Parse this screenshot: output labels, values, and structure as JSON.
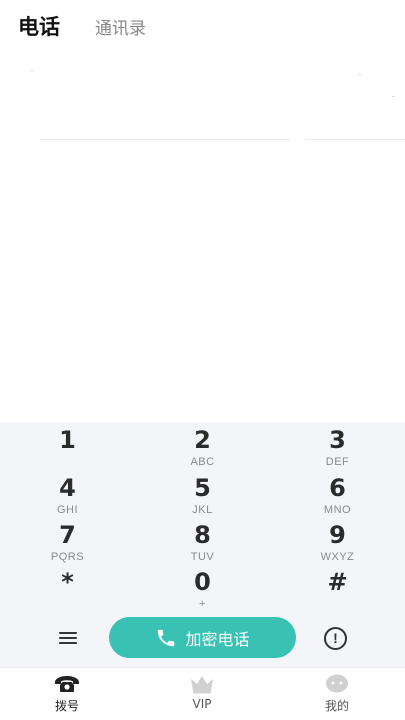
{
  "header": {
    "tab_phone": "电话",
    "tab_contacts": "通讯录"
  },
  "keypad": {
    "keys": [
      {
        "digit": "1",
        "letters": ""
      },
      {
        "digit": "2",
        "letters": "ABC"
      },
      {
        "digit": "3",
        "letters": "DEF"
      },
      {
        "digit": "4",
        "letters": "GHI"
      },
      {
        "digit": "5",
        "letters": "JKL"
      },
      {
        "digit": "6",
        "letters": "MNO"
      },
      {
        "digit": "7",
        "letters": "PQRS"
      },
      {
        "digit": "8",
        "letters": "TUV"
      },
      {
        "digit": "9",
        "letters": "WXYZ"
      },
      {
        "digit": "*",
        "letters": ""
      },
      {
        "digit": "0",
        "letters": "+"
      },
      {
        "digit": "#",
        "letters": ""
      }
    ]
  },
  "actions": {
    "call_label": "加密电话",
    "info_glyph": "!"
  },
  "nav": {
    "dial": "拨号",
    "vip": "VIP",
    "mine": "我的"
  },
  "colors": {
    "accent": "#39c1b3",
    "keypad_bg": "#f4f5f9",
    "inactive_icon": "#d0d0d0"
  }
}
